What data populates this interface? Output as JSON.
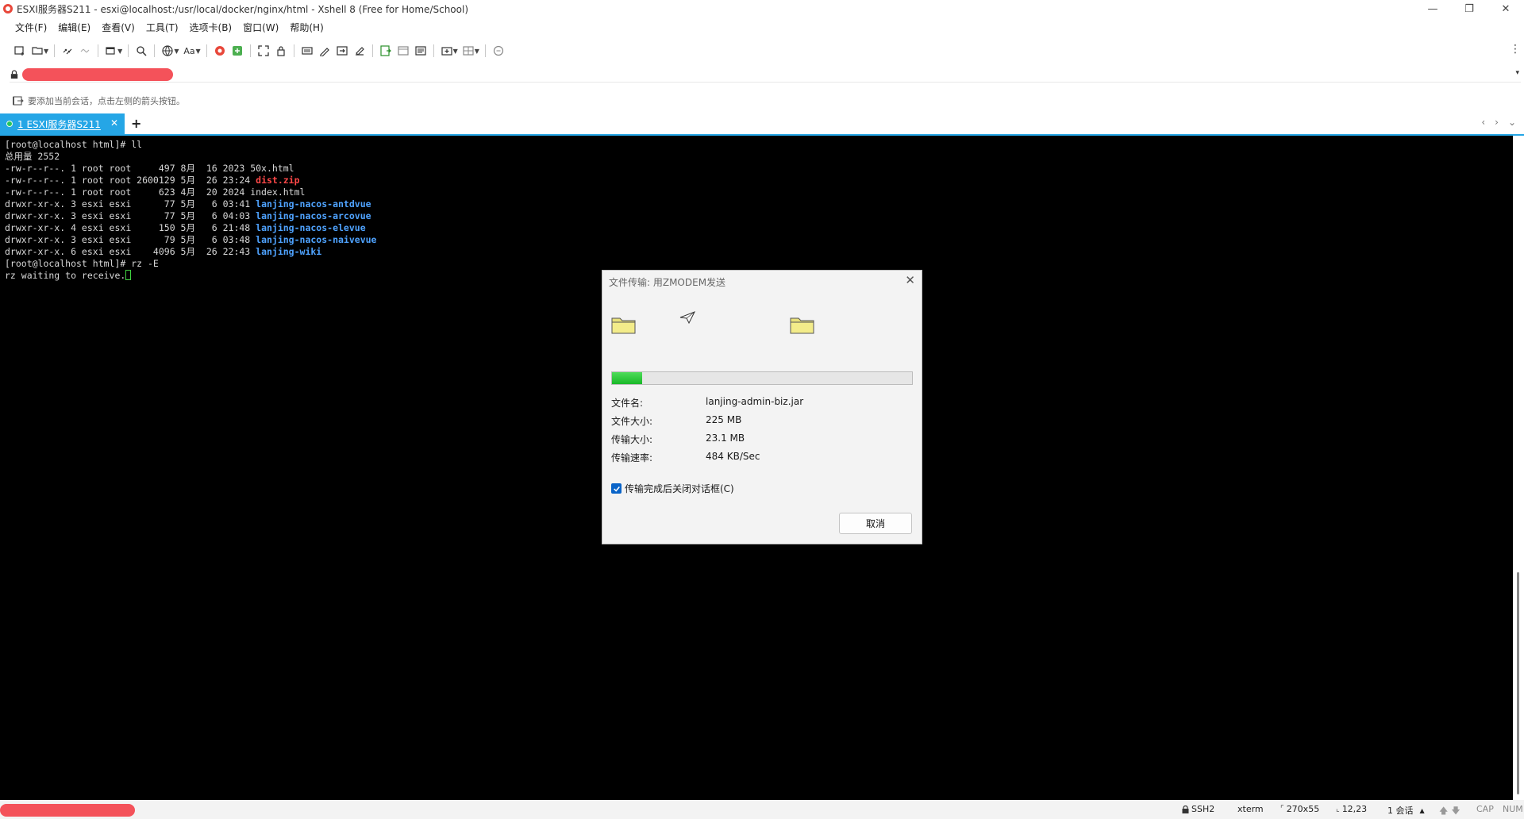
{
  "window": {
    "title": "ESXI服务器S211 - esxi@localhost:/usr/local/docker/nginx/html - Xshell 8 (Free for Home/School)",
    "controls": [
      "—",
      "❐",
      "✕"
    ]
  },
  "menu": [
    "文件(F)",
    "编辑(E)",
    "查看(V)",
    "工具(T)",
    "选项卡(B)",
    "窗口(W)",
    "帮助(H)"
  ],
  "toolbar": {
    "font_label": "Aa",
    "icons": [
      "new-session-icon",
      "open-folder-icon",
      "reconnect-icon",
      "disconnect-icon",
      "new-window-icon",
      "find-icon",
      "globe-icon",
      "font-icon",
      "xftp-icon",
      "transfer-icon",
      "fullscreen-icon",
      "lock-icon",
      "keyboard-icon",
      "script-icon",
      "send-icon",
      "compose-icon",
      "log-icon",
      "tab-icon",
      "split-icon",
      "chat-icon",
      "more-icon"
    ]
  },
  "address": {
    "dropdown": "▾"
  },
  "hint": {
    "text": "要添加当前会话，点击左侧的箭头按钮。"
  },
  "tabs": [
    {
      "label": "1 ESXI服务器S211",
      "active": true,
      "status_color": "#22c55e"
    }
  ],
  "tab_controls": {
    "add": "+",
    "prev": "‹",
    "next": "›",
    "menu": "⌄"
  },
  "terminal": {
    "lines": [
      {
        "text": "[root@localhost html]# ll"
      },
      {
        "text": "总用量 2552"
      },
      {
        "text": "-rw-r--r--. 1 root root     497 8月  16 2023 50x.html"
      },
      {
        "text": "-rw-r--r--. 1 root root 2600129 5月  26 23:24 ",
        "colored": "dist.zip",
        "color": "red"
      },
      {
        "text": "-rw-r--r--. 1 root root     623 4月  20 2024 index.html"
      },
      {
        "text": "drwxr-xr-x. 3 esxi esxi      77 5月   6 03:41 ",
        "colored": "lanjing-nacos-antdvue",
        "color": "blue"
      },
      {
        "text": "drwxr-xr-x. 3 esxi esxi      77 5月   6 04:03 ",
        "colored": "lanjing-nacos-arcovue",
        "color": "blue"
      },
      {
        "text": "drwxr-xr-x. 4 esxi esxi     150 5月   6 21:48 ",
        "colored": "lanjing-nacos-elevue",
        "color": "blue"
      },
      {
        "text": "drwxr-xr-x. 3 esxi esxi      79 5月   6 03:48 ",
        "colored": "lanjing-nacos-naivevue",
        "color": "blue"
      },
      {
        "text": "drwxr-xr-x. 6 esxi esxi    4096 5月  26 22:43 ",
        "colored": "lanjing-wiki",
        "color": "blue"
      },
      {
        "text": "[root@localhost html]# rz -E"
      },
      {
        "text": "rz waiting to receive.",
        "cursor": true
      }
    ]
  },
  "dialog": {
    "title": "文件传输: 用ZMODEM发送",
    "close": "✕",
    "progress_fraction": 0.1,
    "fields": [
      {
        "label": "文件名:",
        "value": "lanjing-admin-biz.jar"
      },
      {
        "label": "文件大小:",
        "value": "225 MB"
      },
      {
        "label": "传输大小:",
        "value": "23.1 MB"
      },
      {
        "label": "传输速率:",
        "value": "484 KB/Sec"
      }
    ],
    "checkbox": {
      "label": "传输完成后关闭对话框(C)",
      "checked": true
    },
    "cancel": "取消"
  },
  "status": {
    "protocol": "SSH2",
    "term": "xterm",
    "size": "270x55",
    "cursor_pos": "12,23",
    "sessions": "1 会话",
    "cap": "CAP",
    "num": "NUM"
  },
  "colors": {
    "accent": "#25a6e6",
    "redaction": "#f4525a",
    "terminal_bg": "#000000",
    "progress": "#19b828"
  }
}
